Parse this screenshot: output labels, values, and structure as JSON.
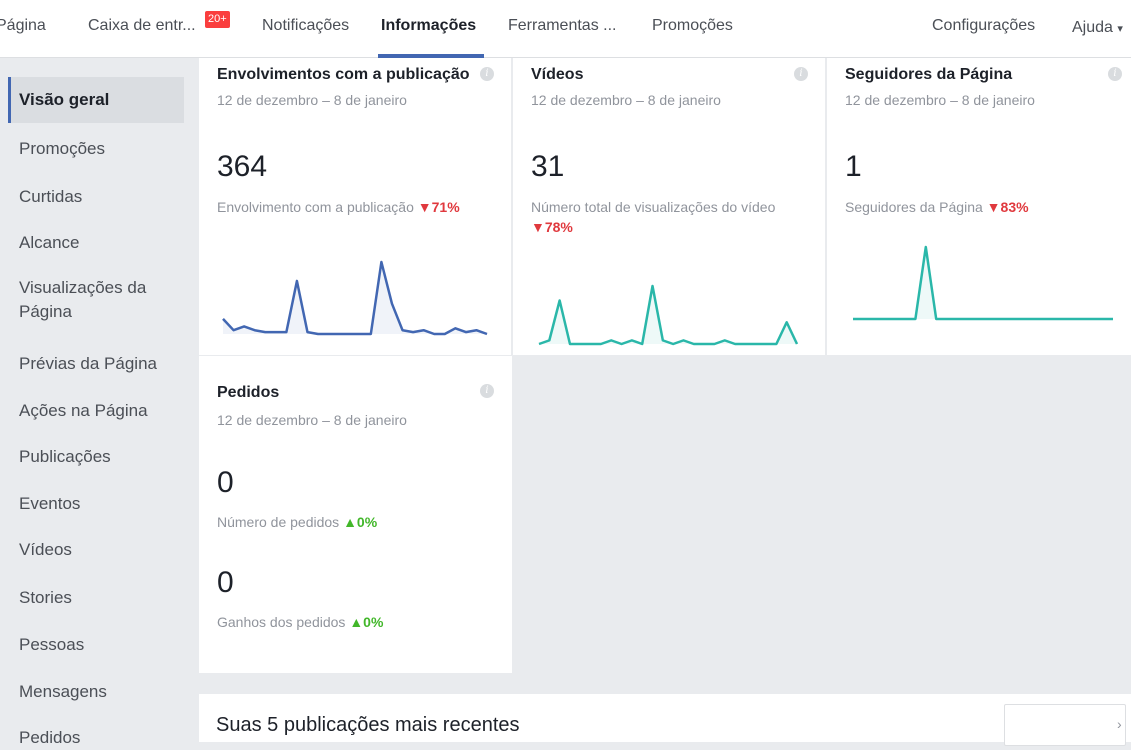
{
  "topnav": {
    "tabs": [
      {
        "label": "Página"
      },
      {
        "label": "Caixa de entr..."
      },
      {
        "label": "Notificações"
      },
      {
        "label": "Informações"
      },
      {
        "label": "Ferramentas ..."
      },
      {
        "label": "Promoções"
      }
    ],
    "inbox_badge": "20+",
    "settings_label": "Configurações",
    "help_label": "Ajuda",
    "help_caret": "▾"
  },
  "sidebar": {
    "items": [
      {
        "label": "Visão geral"
      },
      {
        "label": "Promoções"
      },
      {
        "label": "Curtidas"
      },
      {
        "label": "Alcance"
      },
      {
        "label": "Visualizações da Página"
      },
      {
        "label": "Prévias da Página"
      },
      {
        "label": "Ações na Página"
      },
      {
        "label": "Publicações"
      },
      {
        "label": "Eventos"
      },
      {
        "label": "Vídeos"
      },
      {
        "label": "Stories"
      },
      {
        "label": "Pessoas"
      },
      {
        "label": "Mensagens"
      },
      {
        "label": "Pedidos"
      }
    ]
  },
  "cards": {
    "engagement": {
      "title": "Envolvimentos com a publicação",
      "date_range": "12 de dezembro – 8 de janeiro",
      "value": "364",
      "label": "Envolvimento com a publicação",
      "delta": "▼71%",
      "spark_color": "#4267b2",
      "spark": [
        4,
        1,
        2,
        1,
        0.5,
        0.5,
        0.5,
        14,
        0.5,
        0,
        0,
        0,
        0,
        0,
        0,
        19,
        8,
        1,
        0.5,
        1,
        0,
        0,
        1.5,
        0.5,
        1,
        0
      ]
    },
    "videos": {
      "title": "Vídeos",
      "date_range": "12 de dezembro – 8 de janeiro",
      "value": "31",
      "label": "Número total de visualizações do vídeo",
      "delta": "▼78%",
      "spark_color": "#2ab7a9",
      "spark": [
        0,
        0.5,
        6,
        0,
        0,
        0,
        0,
        0.5,
        0,
        0.5,
        0,
        8,
        0.5,
        0,
        0.5,
        0,
        0,
        0,
        0.5,
        0,
        0,
        0,
        0,
        0,
        3,
        0
      ]
    },
    "followers": {
      "title": "Seguidores da Página",
      "date_range": "12 de dezembro – 8 de janeiro",
      "value": "1",
      "label": "Seguidores da Página",
      "delta": "▼83%",
      "spark_color": "#2ab7a9",
      "spark": [
        0,
        0,
        0,
        0,
        0,
        0,
        0,
        1,
        0,
        0,
        0,
        0,
        0,
        0,
        0,
        0,
        0,
        0,
        0,
        0,
        0,
        0,
        0,
        0,
        0,
        0
      ]
    },
    "orders": {
      "title": "Pedidos",
      "date_range": "12 de dezembro – 8 de janeiro",
      "count_value": "0",
      "count_label": "Número de pedidos",
      "count_delta": "▲0%",
      "earnings_value": "0",
      "earnings_label": "Ganhos dos pedidos",
      "earnings_delta": "▲0%"
    }
  },
  "recent": {
    "title": "Suas 5 publicações mais recentes"
  }
}
